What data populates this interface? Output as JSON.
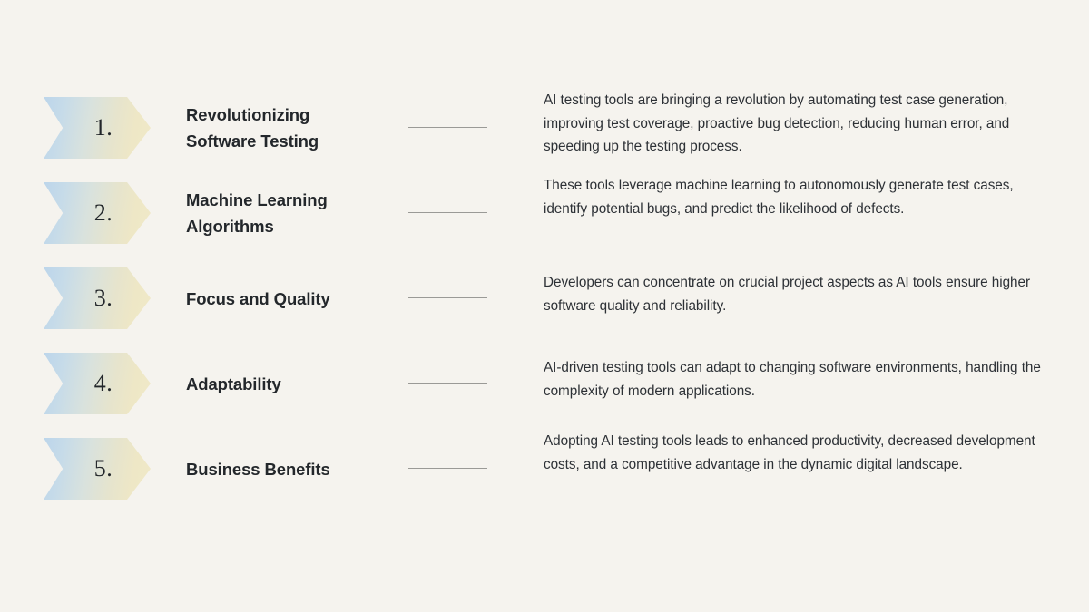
{
  "theme": {
    "background": "#f5f3ee",
    "chevron_gradient_start": "#bcd5ea",
    "chevron_gradient_end": "#f0e9c8",
    "title_color": "#23272b",
    "body_color": "#2d3136",
    "connector_color": "#9a9a96"
  },
  "items": [
    {
      "number": "1.",
      "title_line1": "Revolutionizing",
      "title_line2": "Software Testing",
      "description": "AI testing tools are bringing a revolution by automating test case generation, improving test coverage, proactive bug detection, reducing human error, and speeding up the testing process."
    },
    {
      "number": "2.",
      "title_line1": "Machine Learning",
      "title_line2": "Algorithms",
      "description": "These tools leverage machine learning to autonomously generate test cases, identify potential bugs, and predict the likelihood of defects."
    },
    {
      "number": "3.",
      "title_line1": "Focus and Quality",
      "title_line2": "",
      "description": "Developers can concentrate on crucial project aspects as AI tools ensure higher software quality and reliability."
    },
    {
      "number": "4.",
      "title_line1": "Adaptability",
      "title_line2": "",
      "description": "AI-driven testing tools can adapt to changing software environments, handling the complexity of modern applications."
    },
    {
      "number": "5.",
      "title_line1": "Business Benefits",
      "title_line2": "",
      "description": "Adopting AI testing tools leads to enhanced productivity, decreased development costs, and a competitive advantage in the dynamic digital landscape."
    }
  ]
}
